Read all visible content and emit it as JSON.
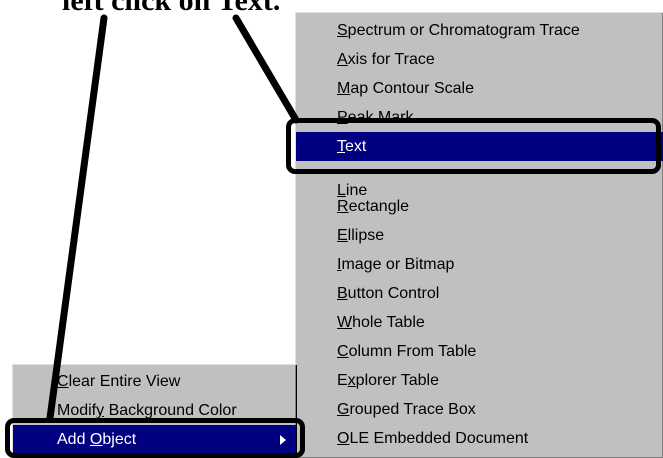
{
  "instruction": {
    "text_before": "left click on ",
    "text_bold_target": "Text."
  },
  "submenu": {
    "items": [
      {
        "prefix": "",
        "ul": "S",
        "rest": "pectrum or Chromatogram Trace"
      },
      {
        "prefix": "",
        "ul": "A",
        "rest": "xis for Trace"
      },
      {
        "prefix": "",
        "ul": "M",
        "rest": "ap Contour Scale"
      },
      {
        "prefix": "",
        "ul": "P",
        "rest": "eak Mark"
      },
      {
        "prefix": "",
        "ul": "T",
        "rest": "ext",
        "selected": true
      },
      {
        "prefix": "",
        "ul": "L",
        "rest": "ine"
      },
      {
        "prefix": "",
        "ul": "R",
        "rest": "ectangle"
      },
      {
        "prefix": "",
        "ul": "E",
        "rest": "llipse"
      },
      {
        "prefix": "",
        "ul": "I",
        "rest": "mage or Bitmap"
      },
      {
        "prefix": "",
        "ul": "B",
        "rest": "utton Control"
      },
      {
        "prefix": "",
        "ul": "W",
        "rest": "hole Table"
      },
      {
        "prefix": "",
        "ul": "C",
        "rest": "olumn From Table"
      },
      {
        "prefix": "E",
        "ul": "x",
        "rest": "plorer Table"
      },
      {
        "prefix": "",
        "ul": "G",
        "rest": "rouped Trace Box"
      },
      {
        "prefix": "",
        "ul": "O",
        "rest": "LE Embedded Document"
      }
    ]
  },
  "context_menu": {
    "items": [
      {
        "prefix": "",
        "ul": "C",
        "rest": "lear Entire View"
      },
      {
        "prefix": "Modif",
        "ul": "y",
        "rest": " Background Color"
      },
      {
        "prefix": "Add ",
        "ul": "O",
        "rest": "bject",
        "selected": true,
        "has_submenu": true
      }
    ]
  },
  "colors": {
    "menu_bg": "#c0c0c0",
    "highlight_bg": "#000080",
    "highlight_fg": "#ffffff",
    "callout": "#000000"
  },
  "icons": {
    "submenu_arrow": "triangle-right-icon"
  }
}
